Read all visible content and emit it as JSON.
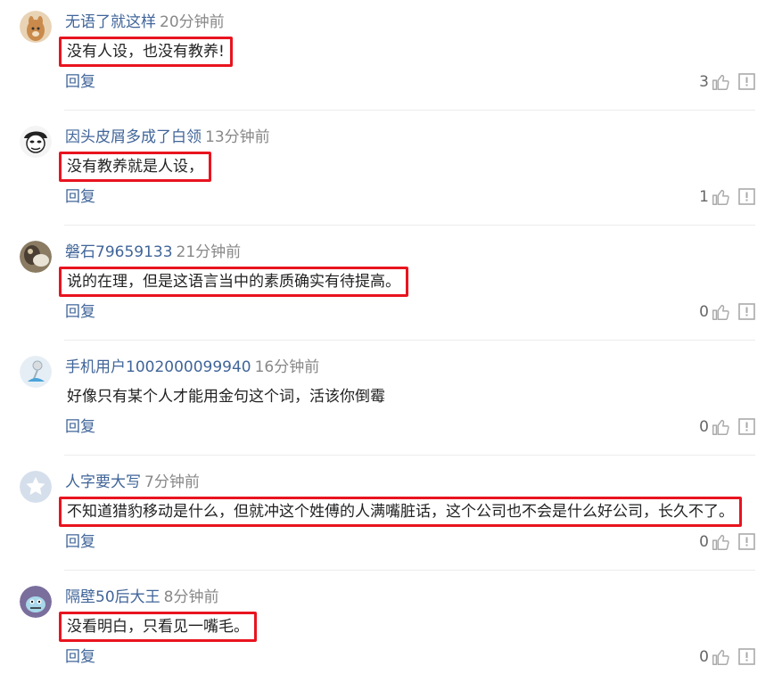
{
  "comments": [
    {
      "user": "无语了就这样",
      "time": "20分钟前",
      "text": "没有人设，也没有教养!",
      "likes": "3",
      "reply": "回复",
      "highlighted": true,
      "avatar": "alpaca-avatar"
    },
    {
      "user": "因头皮屑多成了白领",
      "time": "13分钟前",
      "text": "没有教养就是人设，",
      "likes": "1",
      "reply": "回复",
      "highlighted": true,
      "avatar": "meme-face-avatar"
    },
    {
      "user": "磐石79659133",
      "time": "21分钟前",
      "text": "说的在理，但是这语言当中的素质确实有待提高。",
      "likes": "0",
      "reply": "回复",
      "highlighted": true,
      "avatar": "photo-avatar"
    },
    {
      "user": "手机用户1002000099940",
      "time": "16分钟前",
      "text": "好像只有某个人才能用金句这个词，活该你倒霉",
      "likes": "0",
      "reply": "回复",
      "highlighted": false,
      "avatar": "lamp-avatar"
    },
    {
      "user": "人字要大写",
      "time": "7分钟前",
      "text": "不知道猎豹移动是什么，但就冲这个姓傅的人满嘴脏话，这个公司也不会是什么好公司，长久不了。",
      "likes": "0",
      "reply": "回复",
      "highlighted": true,
      "avatar": "star-avatar"
    },
    {
      "user": "隔壁50后大王",
      "time": "8分钟前",
      "text": "没看明白，只看见一嘴毛。",
      "likes": "0",
      "reply": "回复",
      "highlighted": true,
      "avatar": "monster-avatar"
    }
  ],
  "colors": {
    "username": "#406599",
    "highlight_border": "#e8141f",
    "meta": "#888888"
  }
}
